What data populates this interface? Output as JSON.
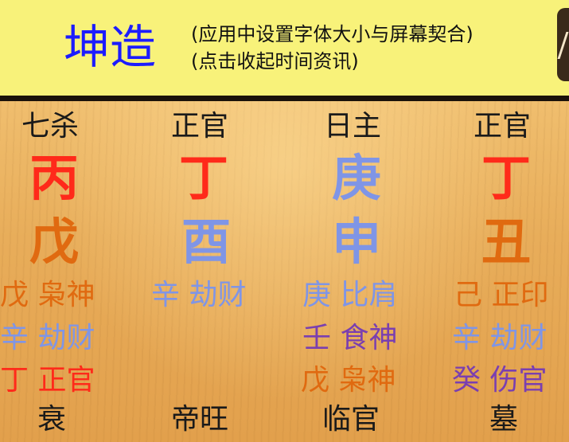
{
  "header": {
    "title": "坤造",
    "note_line1": "(应用中设置字体大小与屏幕契合)",
    "note_line2": "(点击收起时间资讯)"
  },
  "colors": {
    "header_bg": "#f8f27a",
    "title": "#1c1cff",
    "fire": "#ff2a1a",
    "earth": "#e06a10",
    "metal": "#7f95e6",
    "water": "#7a3fb0"
  },
  "pillars": [
    {
      "god": "七杀",
      "stem": "丙",
      "branch": "戊",
      "hidden": [
        "戊 枭神",
        "辛 劫财",
        "丁 正官"
      ],
      "stage": "衰"
    },
    {
      "god": "正官",
      "stem": "丁",
      "branch": "酉",
      "hidden": [
        "辛 劫财"
      ],
      "stage": "帝旺"
    },
    {
      "god": "日主",
      "stem": "庚",
      "branch": "申",
      "hidden": [
        "庚 比肩",
        "壬 食神",
        "戊 枭神"
      ],
      "stage": "临官"
    },
    {
      "god": "正官",
      "stem": "丁",
      "branch": "丑",
      "hidden": [
        "己 正印",
        "辛 劫财",
        "癸 伤官"
      ],
      "stage": "墓"
    }
  ]
}
